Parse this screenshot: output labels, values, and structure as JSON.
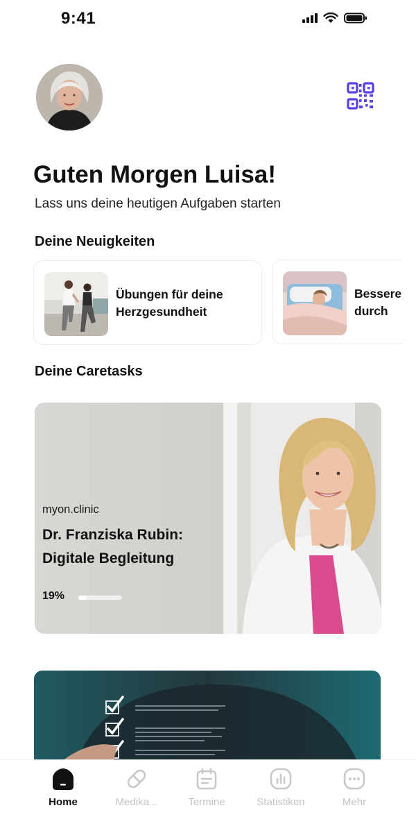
{
  "status_bar": {
    "time": "9:41"
  },
  "header": {
    "avatar": "user-avatar-photo",
    "qr_icon": "qr-code-icon",
    "accent": "#5b3fe0"
  },
  "greeting": {
    "title": "Guten Morgen Luisa!",
    "subtitle": "Lass uns deine heutigen Aufgaben starten"
  },
  "news": {
    "section_title": "Deine Neuigkeiten",
    "items": [
      {
        "title": "Übungen für deine Herzgesundheit",
        "image": "exercise-photo"
      },
      {
        "title": "Besserer Schlaf durch",
        "image": "sleep-photo"
      }
    ]
  },
  "caretasks": {
    "section_title": "Deine Caretasks",
    "items": [
      {
        "brand": "myon.clinic",
        "title": "Dr. Franziska Rubin: Digitale Begleitung",
        "progress_label": "19%",
        "progress": 0.19
      },
      {
        "image": "checklist-photo"
      }
    ]
  },
  "tab_bar": {
    "active_color": "#111111",
    "inactive_color": "#c4c4c4",
    "tabs": [
      {
        "label": "Home",
        "icon": "home-icon",
        "active": true
      },
      {
        "label": "Medika...",
        "icon": "pill-icon",
        "active": false
      },
      {
        "label": "Termine",
        "icon": "calendar-icon",
        "active": false
      },
      {
        "label": "Statistiken",
        "icon": "chart-icon",
        "active": false
      },
      {
        "label": "Mehr",
        "icon": "more-icon",
        "active": false
      }
    ]
  }
}
